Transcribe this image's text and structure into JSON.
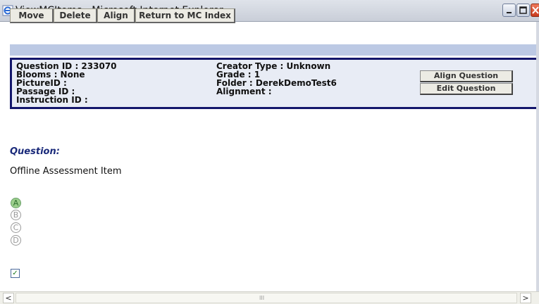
{
  "window": {
    "title": "ViewMCItems - Microsoft Internet Explorer",
    "minimize_glyph": "–",
    "maximize_glyph": "□",
    "close_glyph": "✕"
  },
  "toolbar": {
    "move_label": "Move",
    "delete_label": "Delete",
    "align_label": "Align",
    "return_label": "Return to MC Index"
  },
  "info": {
    "question_id": "Question ID : 233070",
    "blooms": "Blooms : None",
    "picture_id": "PictureID :",
    "passage_id": "Passage ID :",
    "instruction_id": "Instruction ID :",
    "creator_type": "Creator Type : Unknown",
    "grade": "Grade : 1",
    "folder": "Folder : DerekDemoTest6",
    "alignment": "Alignment :",
    "align_question_label": "Align Question",
    "edit_question_label": "Edit Question"
  },
  "question": {
    "label": "Question:",
    "text": "Offline Assessment Item",
    "options": [
      "A",
      "B",
      "C",
      "D"
    ],
    "selected": "A"
  },
  "checkbox": {
    "checked": true,
    "glyph": "✓"
  },
  "scrollbar": {
    "left_glyph": "<",
    "right_glyph": ">",
    "grip_glyph": "III"
  },
  "colors": {
    "panel_border": "#13166b",
    "panel_bg": "#e8ecf5",
    "bluebar": "#bcc9e4",
    "question_label": "#1a2a7a",
    "selected_option": "#9ccf8c"
  }
}
